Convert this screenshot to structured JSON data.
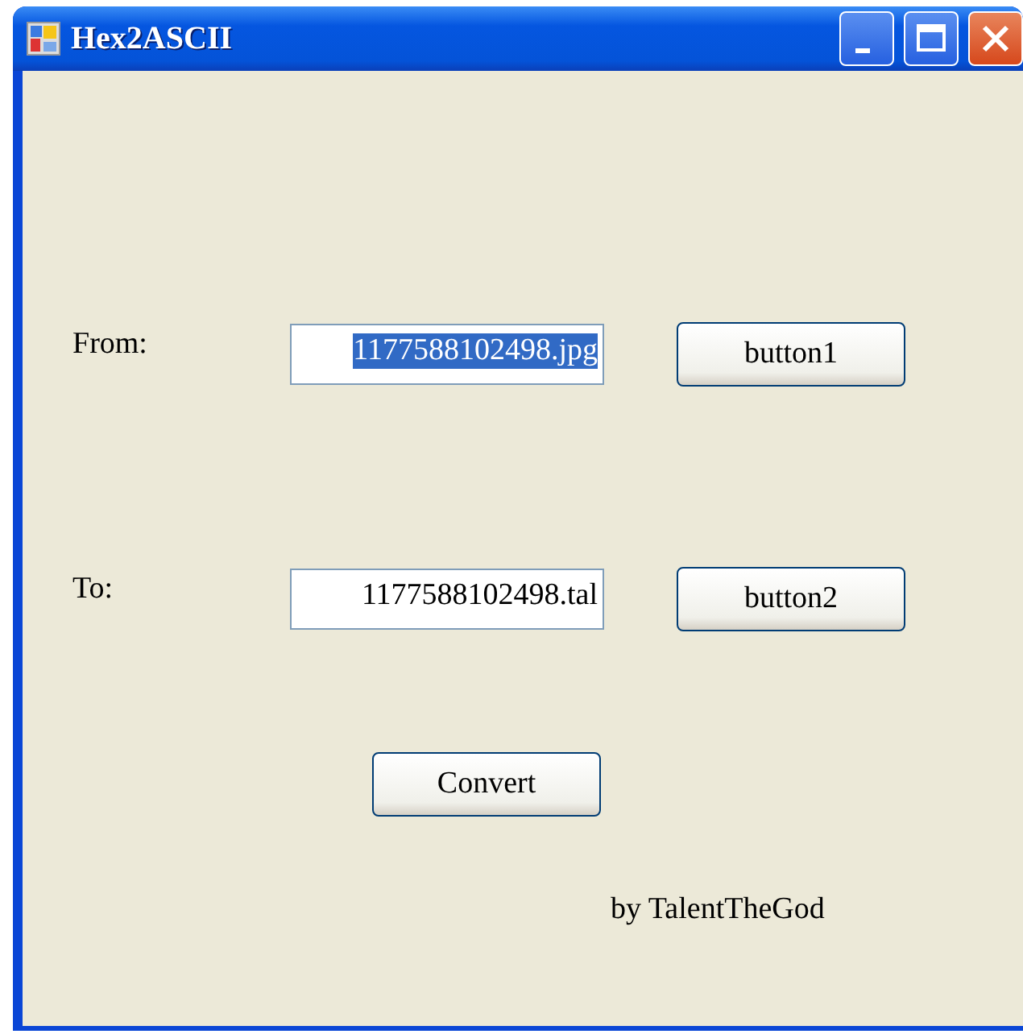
{
  "window": {
    "title": "Hex2ASCII"
  },
  "rows": [
    {
      "label": "From:",
      "value": "1177588102498.jpg",
      "text_selected": true,
      "button": "button1"
    },
    {
      "label": "To:",
      "value": "1177588102498.tal",
      "text_selected": false,
      "button": "button2"
    }
  ],
  "convert_button": "Convert",
  "credit": "by TalentTheGod"
}
